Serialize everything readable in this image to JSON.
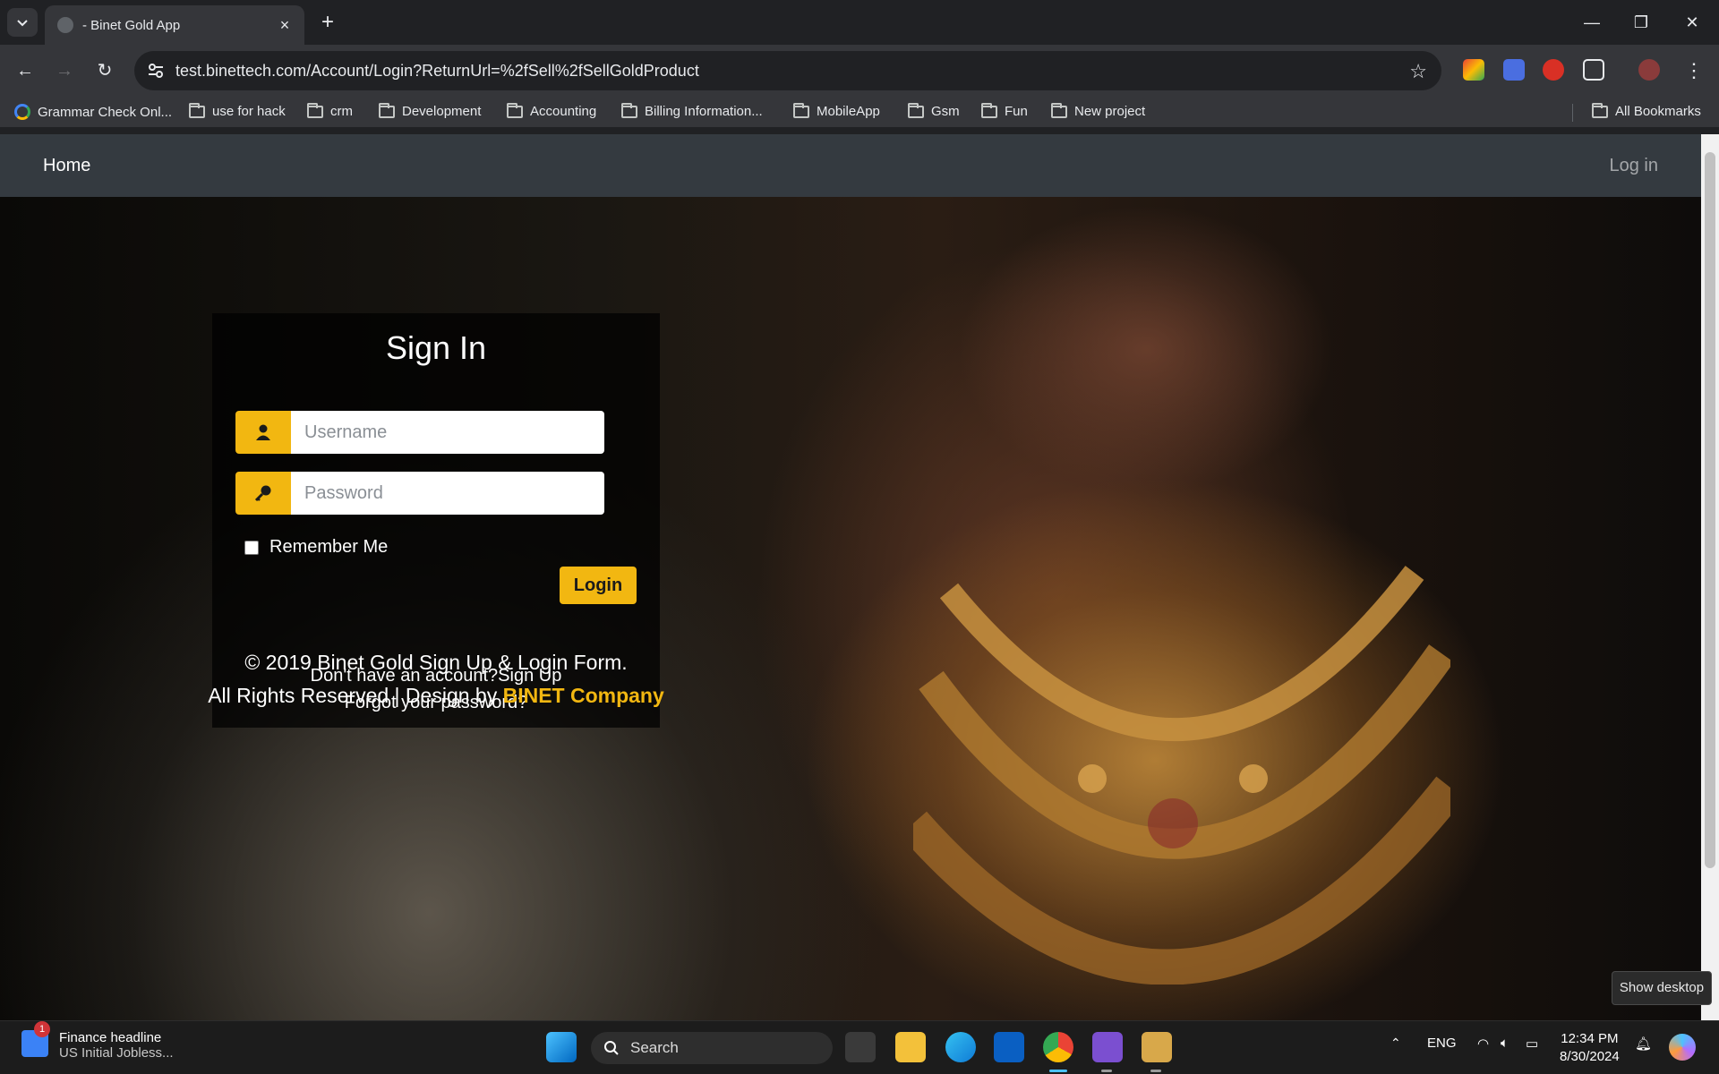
{
  "browser": {
    "tab_title": "- Binet Gold App",
    "url": "test.binettech.com/Account/Login?ReturnUrl=%2fSell%2fSellGoldProduct",
    "bookmarks": [
      {
        "label": "Grammar Check Onl...",
        "icon": "google-icon"
      },
      {
        "label": "use for hack",
        "icon": "folder-icon"
      },
      {
        "label": "crm",
        "icon": "folder-icon"
      },
      {
        "label": "Development",
        "icon": "folder-icon"
      },
      {
        "label": "Accounting",
        "icon": "folder-icon"
      },
      {
        "label": "Billing Information...",
        "icon": "folder-icon"
      },
      {
        "label": "MobileApp",
        "icon": "folder-icon"
      },
      {
        "label": "Gsm",
        "icon": "folder-icon"
      },
      {
        "label": "Fun",
        "icon": "folder-icon"
      },
      {
        "label": "New project",
        "icon": "folder-icon"
      }
    ],
    "all_bookmarks": "All Bookmarks"
  },
  "page": {
    "nav": {
      "home": "Home",
      "login": "Log in"
    },
    "signin": {
      "title": "Sign In",
      "username_placeholder": "Username",
      "password_placeholder": "Password",
      "remember_me": "Remember Me",
      "login_button": "Login",
      "no_account": "Don't have an account?Sign Up",
      "forgot": "Forgot your password?"
    },
    "footer": {
      "line1": "© 2019 Binet Gold Sign Up & Login Form.",
      "line2_prefix": "All Rights Reserved | Design by ",
      "brand": "BINET Company"
    },
    "tooltip": "Show desktop"
  },
  "taskbar": {
    "news_title": "Finance headline",
    "news_sub": "US Initial Jobless...",
    "news_badge": "1",
    "search": "Search",
    "lang": "ENG",
    "time": "12:34 PM",
    "date": "8/30/2024"
  },
  "colors": {
    "accent": "#f2b711",
    "navbar": "#343a40"
  }
}
